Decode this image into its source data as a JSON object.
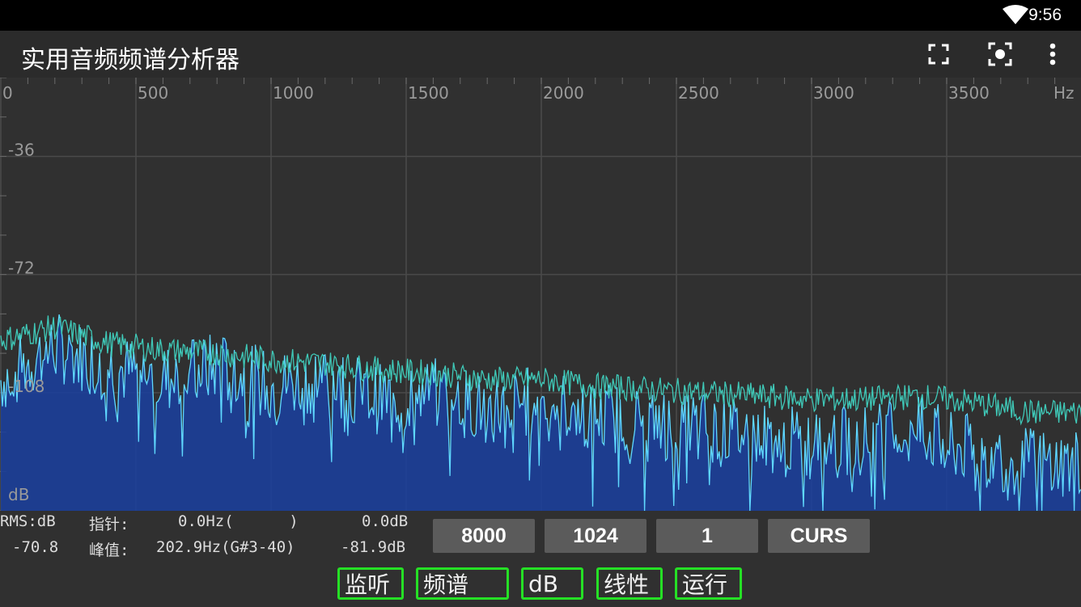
{
  "statusbar": {
    "time": "9:56",
    "wifi_icon": "wifi-icon"
  },
  "appbar": {
    "title": "实用音频频谱分析器",
    "icons": [
      "fullscreen-icon",
      "screenshot-icon",
      "more-vert-icon"
    ]
  },
  "spectrum": {
    "x_ticks": [
      "0",
      "500",
      "1000",
      "1500",
      "2000",
      "2500",
      "3000",
      "3500"
    ],
    "x_unit": "Hz",
    "y_ticks": [
      "-36",
      "-72",
      "-108"
    ],
    "y_unit": "dB",
    "colors": {
      "peak_line": "#3fc9b8",
      "live_line": "#5fd8ff",
      "fill": "#1c3f9a",
      "grid": "#4a4a4a"
    }
  },
  "chart_data": {
    "type": "area",
    "x_range": [
      0,
      4000
    ],
    "y_range": [
      -144,
      -12
    ],
    "series": [
      {
        "x": [
          0,
          200,
          400,
          600,
          800,
          1000,
          1200,
          1400,
          1600,
          1800,
          2000,
          2200,
          2400,
          2600,
          2800,
          3000,
          3200,
          3400,
          3600,
          3800,
          4000
        ],
        "y": [
          -92,
          -88,
          -93,
          -95,
          -96,
          -98,
          -99,
          -101,
          -102,
          -104,
          -104,
          -106,
          -107,
          -108,
          -109,
          -110,
          -110,
          -109,
          -111,
          -114,
          -114
        ]
      },
      {
        "x": [
          0,
          200,
          400,
          600,
          800,
          1000,
          1200,
          1400,
          1600,
          1800,
          2000,
          2200,
          2400,
          2600,
          2800,
          3000,
          3200,
          3400,
          3600,
          3800,
          4000
        ],
        "y": [
          -104,
          -94,
          -100,
          -104,
          -100,
          -106,
          -103,
          -110,
          -108,
          -113,
          -110,
          -115,
          -117,
          -118,
          -121,
          -124,
          -122,
          -120,
          -126,
          -129,
          -130
        ]
      }
    ]
  },
  "readout": {
    "row1": {
      "label": "RMS:dB",
      "cursor_label": "指针:",
      "cursor_value": "0.0Hz(      )",
      "cursor_db": "0.0dB"
    },
    "row2": {
      "rms_value": "-70.8",
      "peak_label": "峰值:",
      "peak_value": "202.9Hz(G#3-40)",
      "peak_db": "-81.9dB"
    }
  },
  "buttons": {
    "sample_rate": "8000",
    "fft_size": "1024",
    "average": "1",
    "curs": "CURS"
  },
  "toggles": {
    "monitor": "监听",
    "spectrum": "频谱",
    "db": "dB",
    "linear": "线性",
    "run": "运行"
  }
}
